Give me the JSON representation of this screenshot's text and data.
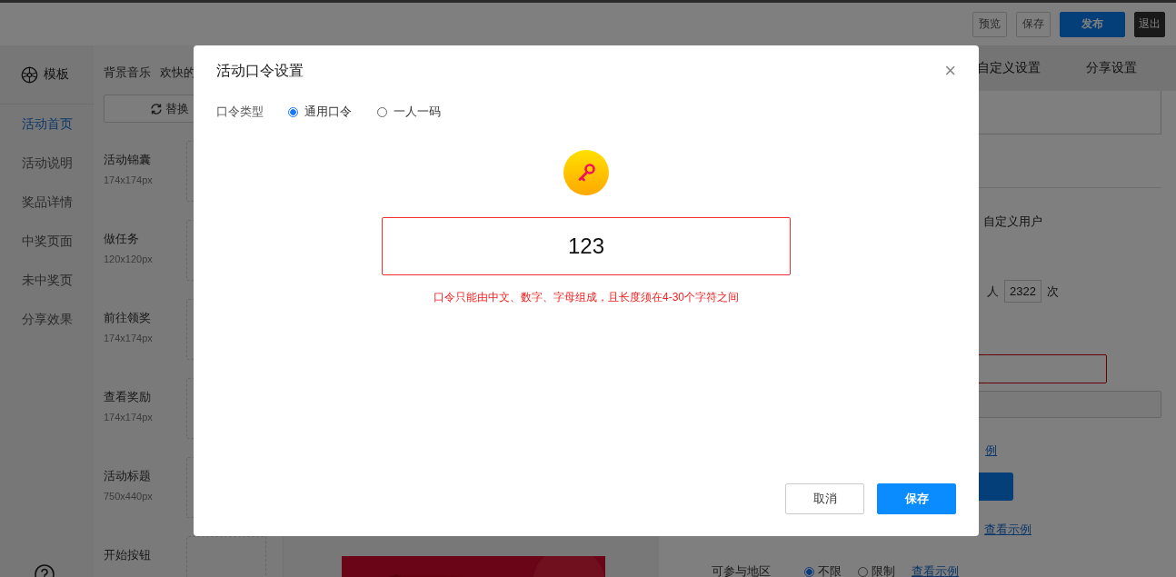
{
  "topbar": {
    "buttons": [
      {
        "label": "预览",
        "kind": "outline"
      },
      {
        "label": "保存",
        "kind": "outline"
      },
      {
        "label": "发布",
        "kind": "primary"
      },
      {
        "label": "退出",
        "kind": "dark"
      }
    ]
  },
  "sidebar": {
    "title": "模板",
    "items": [
      {
        "label": "活动首页",
        "selected": true
      },
      {
        "label": "活动说明",
        "selected": false
      },
      {
        "label": "奖品详情",
        "selected": false
      },
      {
        "label": "中奖页面",
        "selected": false
      },
      {
        "label": "未中奖页",
        "selected": false
      },
      {
        "label": "分享效果",
        "selected": false
      }
    ]
  },
  "assets": {
    "music_label": "背景音乐",
    "music_value": "欢快的",
    "replace_button": "替换",
    "items": [
      {
        "name": "活动锦囊",
        "size": "174x174px"
      },
      {
        "name": "做任务",
        "size": "120x120px"
      },
      {
        "name": "前往领奖",
        "size": "174x174px"
      },
      {
        "name": "查看奖励",
        "size": "174x174px"
      },
      {
        "name": "活动标题",
        "size": "750x440px"
      },
      {
        "name": "开始按钮"
      }
    ]
  },
  "settings": {
    "tabs": [
      {
        "label": "自定义设置"
      },
      {
        "label": "分享设置"
      }
    ],
    "user_option": "自定义用户",
    "limit": {
      "prefix": "人",
      "value": "2322",
      "suffix": "次"
    },
    "link_1": "例",
    "link_2": "查看示例",
    "region": {
      "label": "可参与地区",
      "options": [
        {
          "label": "不限",
          "selected": true
        },
        {
          "label": "限制",
          "selected": false
        }
      ],
      "link": "查看示例"
    }
  },
  "dialog": {
    "title": "活动口令设置",
    "close": "×",
    "type_label": "口令类型",
    "types": [
      {
        "label": "通用口令",
        "selected": true
      },
      {
        "label": "一人一码",
        "selected": false
      }
    ],
    "code": {
      "value": "123",
      "invalid": true
    },
    "error_message": "口令只能由中文、数字、字母组成，且长度须在4-30个字符之间",
    "buttons": [
      {
        "label": "取消",
        "kind": "secondary"
      },
      {
        "label": "保存",
        "kind": "primary"
      }
    ]
  }
}
